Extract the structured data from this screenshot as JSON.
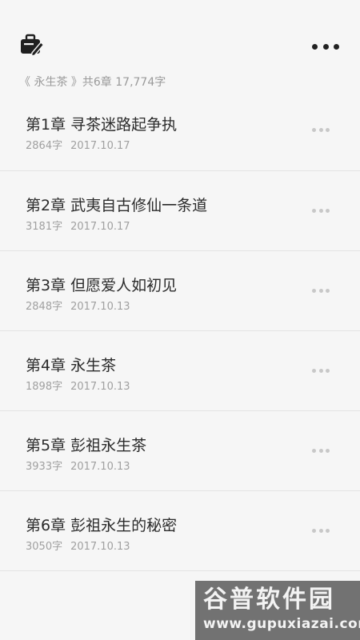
{
  "header": {
    "toolkit_icon": "briefcase-pen-icon",
    "more_icon": "more-horizontal-icon"
  },
  "book_summary": "《 永生茶 》共6章 17,774字",
  "chapters": [
    {
      "title": "第1章 寻茶迷路起争执",
      "words": "2864字",
      "date": "2017.10.17"
    },
    {
      "title": "第2章 武夷自古修仙一条道",
      "words": "3181字",
      "date": "2017.10.17"
    },
    {
      "title": "第3章 但愿爱人如初见",
      "words": "2848字",
      "date": "2017.10.13"
    },
    {
      "title": "第4章 永生茶",
      "words": "1898字",
      "date": "2017.10.13"
    },
    {
      "title": "第5章 彭祖永生茶",
      "words": "3933字",
      "date": "2017.10.13"
    },
    {
      "title": "第6章 彭祖永生的秘密",
      "words": "3050字",
      "date": "2017.10.13"
    }
  ],
  "watermark": {
    "title": "谷普软件园",
    "url": "www.gupuxiazai.com"
  }
}
